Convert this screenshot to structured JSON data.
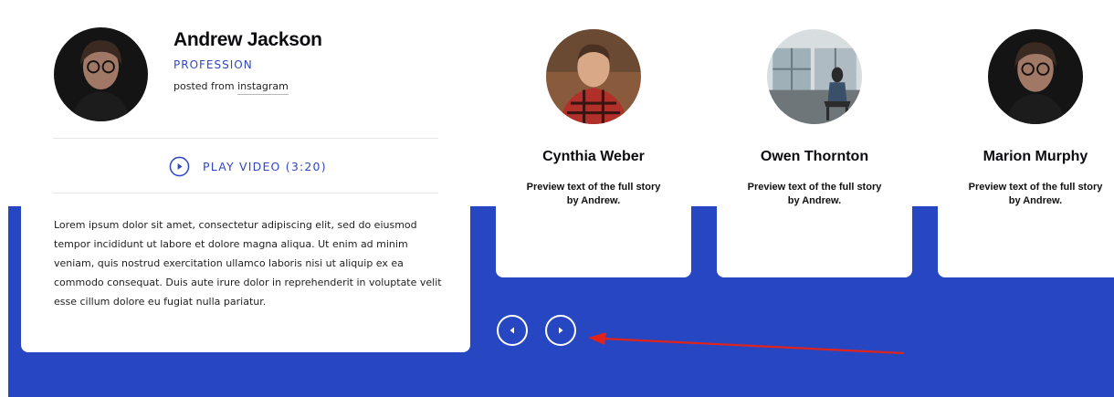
{
  "featured": {
    "name": "Andrew Jackson",
    "profession": "PROFESSION",
    "posted_prefix": "posted from ",
    "posted_source": "instagram",
    "play_label": "PLAY VIDEO (3:20)",
    "body": "Lorem ipsum dolor sit amet, consectetur adipiscing elit, sed do eiusmod tempor incididunt ut labore et dolore magna aliqua. Ut enim ad minim veniam, quis nostrud exercitation ullamco laboris nisi ut aliquip ex ea commodo consequat. Duis aute irure dolor in reprehenderit in voluptate velit esse cillum dolore eu fugiat nulla pariatur."
  },
  "stories": [
    {
      "name": "Cynthia Weber",
      "preview": "Preview text of the full story by Andrew."
    },
    {
      "name": "Owen Thornton",
      "preview": "Preview text of the full story by Andrew."
    },
    {
      "name": "Marion Murphy",
      "preview": "Preview text of the full story by Andrew."
    }
  ],
  "icons": {
    "play": "play-circle-icon",
    "prev": "chevron-left-icon",
    "next": "chevron-right-icon"
  },
  "colors": {
    "accent_blue": "#2746c2",
    "link_blue": "#2f47c0",
    "annotation_red": "#e0241b"
  }
}
